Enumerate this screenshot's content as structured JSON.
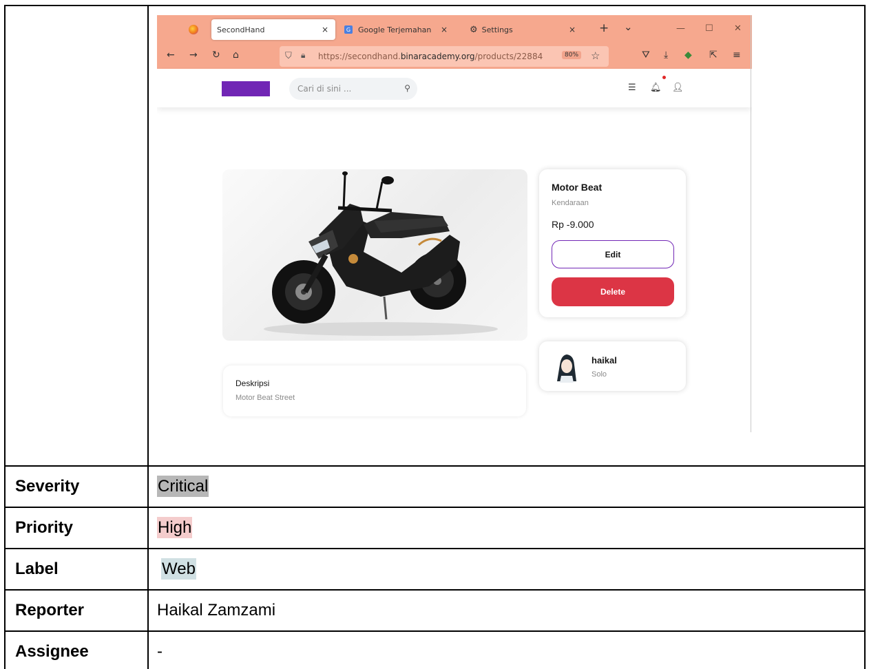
{
  "browser": {
    "tabs": [
      {
        "title": "SecondHand",
        "close": "×"
      },
      {
        "title": "Google Terjemahan",
        "close": "×"
      },
      {
        "title": "Settings",
        "close": "×"
      }
    ],
    "new_tab": "+",
    "tab_list": "⌄",
    "url_prefix": "https://secondhand.",
    "url_domain": "binaracademy.org",
    "url_path": "/products/22884",
    "zoom": "80%"
  },
  "site": {
    "search_placeholder": "Cari di sini ...",
    "brand_color": "#7126b5"
  },
  "product": {
    "name": "Motor Beat",
    "category": "Kendaraan",
    "price": "Rp -9.000",
    "edit_label": "Edit",
    "delete_label": "Delete",
    "description_title": "Deskripsi",
    "description": "Motor Beat Street"
  },
  "seller": {
    "name": "haikal",
    "city": "Solo"
  },
  "report": {
    "rows": [
      {
        "label": "Severity",
        "value": "Critical",
        "highlight": "#b7b7b7"
      },
      {
        "label": "Priority",
        "value": "High",
        "highlight": "#f4cccc"
      },
      {
        "label": "Label",
        "value": "Web",
        "highlight": "#d0e0e3"
      },
      {
        "label": "Reporter",
        "value": "Haikal Zamzami",
        "highlight": ""
      },
      {
        "label": "Assignee",
        "value": "-",
        "highlight": ""
      }
    ]
  }
}
